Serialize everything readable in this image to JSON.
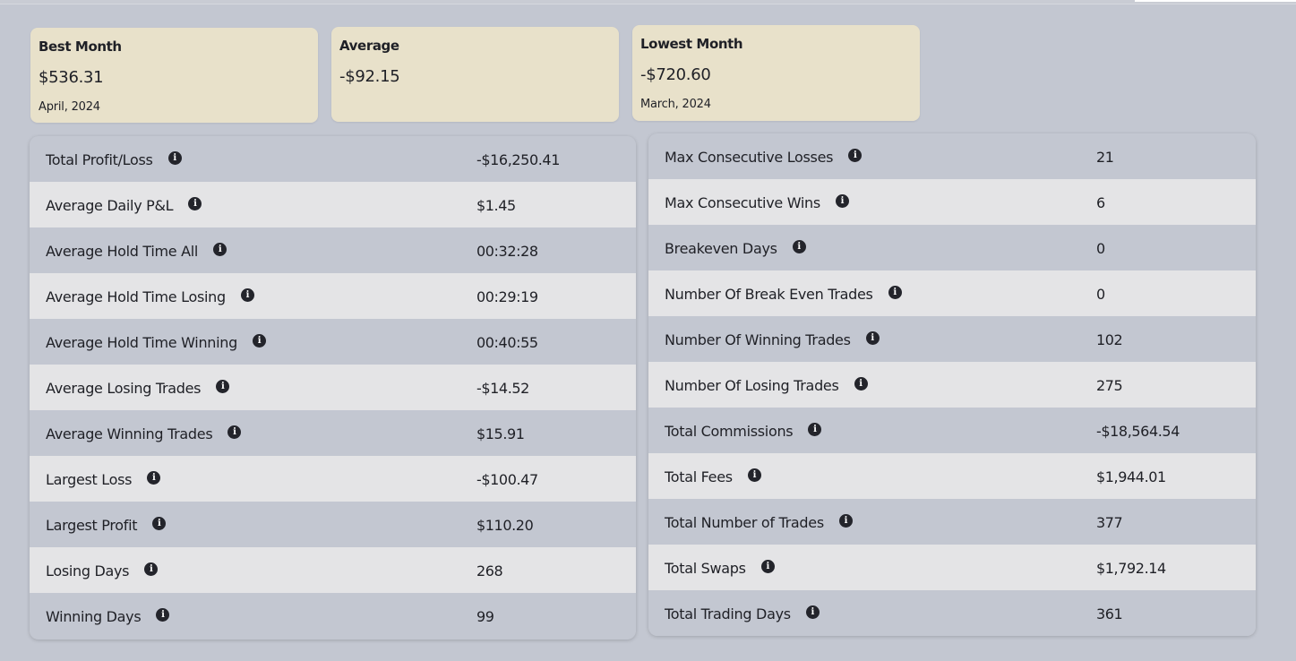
{
  "summary": {
    "best_month": {
      "label": "Best Month",
      "value": "$536.31",
      "date": "April, 2024"
    },
    "average": {
      "label": "Average",
      "value": "-$92.15"
    },
    "lowest_month": {
      "label": "Lowest Month",
      "value": "-$720.60",
      "date": "March, 2024"
    }
  },
  "info_icon_glyph": "i",
  "left_stats": [
    {
      "label": "Total Profit/Loss",
      "value": "-$16,250.41"
    },
    {
      "label": "Average Daily P&L",
      "value": "$1.45"
    },
    {
      "label": "Average Hold Time All",
      "value": "00:32:28"
    },
    {
      "label": "Average Hold Time Losing",
      "value": "00:29:19"
    },
    {
      "label": "Average Hold Time Winning",
      "value": "00:40:55"
    },
    {
      "label": "Average Losing Trades",
      "value": "-$14.52"
    },
    {
      "label": "Average Winning Trades",
      "value": "$15.91"
    },
    {
      "label": "Largest Loss",
      "value": "-$100.47"
    },
    {
      "label": "Largest Profit",
      "value": "$110.20"
    },
    {
      "label": "Losing Days",
      "value": "268"
    },
    {
      "label": "Winning Days",
      "value": "99"
    }
  ],
  "right_stats": [
    {
      "label": "Max Consecutive Losses",
      "value": "21"
    },
    {
      "label": "Max Consecutive Wins",
      "value": "6"
    },
    {
      "label": "Breakeven Days",
      "value": "0"
    },
    {
      "label": "Number Of Break Even Trades",
      "value": "0"
    },
    {
      "label": "Number Of Winning Trades",
      "value": "102"
    },
    {
      "label": "Number Of Losing Trades",
      "value": "275"
    },
    {
      "label": "Total Commissions",
      "value": "-$18,564.54"
    },
    {
      "label": "Total Fees",
      "value": "$1,944.01"
    },
    {
      "label": "Total Number of Trades",
      "value": "377"
    },
    {
      "label": "Total Swaps",
      "value": "$1,792.14"
    },
    {
      "label": "Total Trading Days",
      "value": "361"
    }
  ],
  "colors": {
    "background": "#c3c7d1",
    "summary_card": "#e8e1ca",
    "row_dark": "#c3c7d1",
    "row_light": "#e4e4e6",
    "text": "#1f2026",
    "info_icon": "#23242b"
  }
}
